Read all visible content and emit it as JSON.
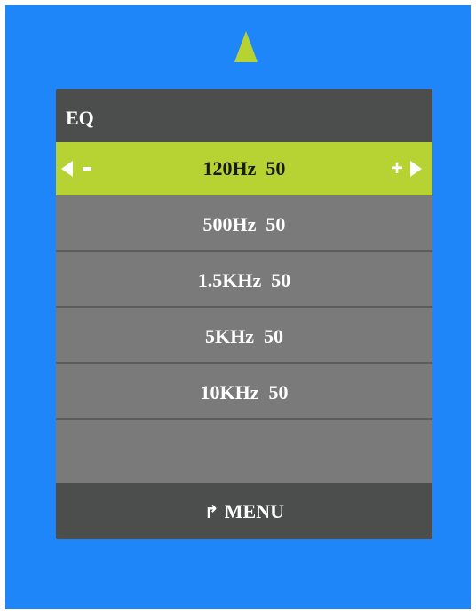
{
  "colors": {
    "background": "#1e86f8",
    "accent": "#b6d233",
    "panel_dark": "#4c4d4d",
    "row": "#7a7a7a"
  },
  "menu": {
    "title": "EQ",
    "items": [
      {
        "label": "120Hz  50",
        "selected": true
      },
      {
        "label": "500Hz  50",
        "selected": false
      },
      {
        "label": "1.5KHz  50",
        "selected": false
      },
      {
        "label": "5KHz  50",
        "selected": false
      },
      {
        "label": "10KHz  50",
        "selected": false
      },
      {
        "label": "",
        "selected": false
      }
    ],
    "minus_icon": "minus-icon",
    "plus_label": "+",
    "footer_label": "MENU",
    "footer_icon": "return-icon"
  },
  "scroll_indicator": "up-arrow-icon"
}
